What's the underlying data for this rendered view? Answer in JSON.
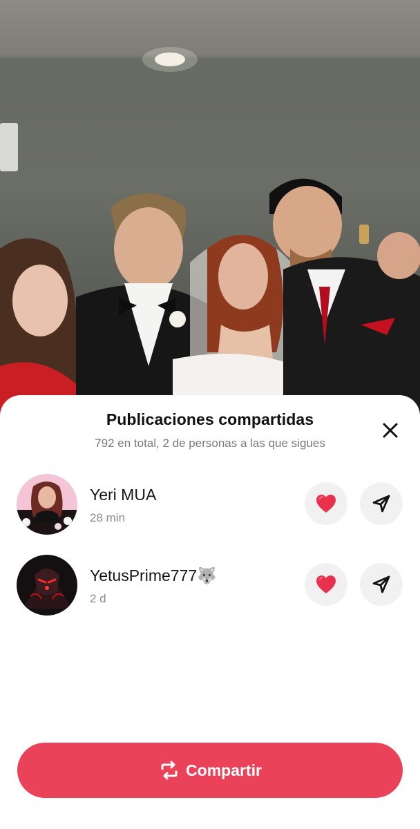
{
  "background_photo": {
    "description_icon": "wedding-group-photo"
  },
  "sheet": {
    "title": "Publicaciones compartidas",
    "subtitle": "792 en total, 2 de personas a las que sigues",
    "close_icon": "close-icon"
  },
  "shares": [
    {
      "name": "Yeri MUA",
      "time": "28 min",
      "liked": true,
      "like_icon": "heart-icon",
      "send_icon": "send-icon"
    },
    {
      "name": "YetusPrime777🐺",
      "time": "2 d",
      "liked": true,
      "like_icon": "heart-icon",
      "send_icon": "send-icon"
    }
  ],
  "share_button": {
    "label": "Compartir",
    "icon": "repost-icon"
  },
  "colors": {
    "accent": "#ea4359",
    "heart": "#e8324d",
    "button_bg": "#f1f1f2"
  }
}
